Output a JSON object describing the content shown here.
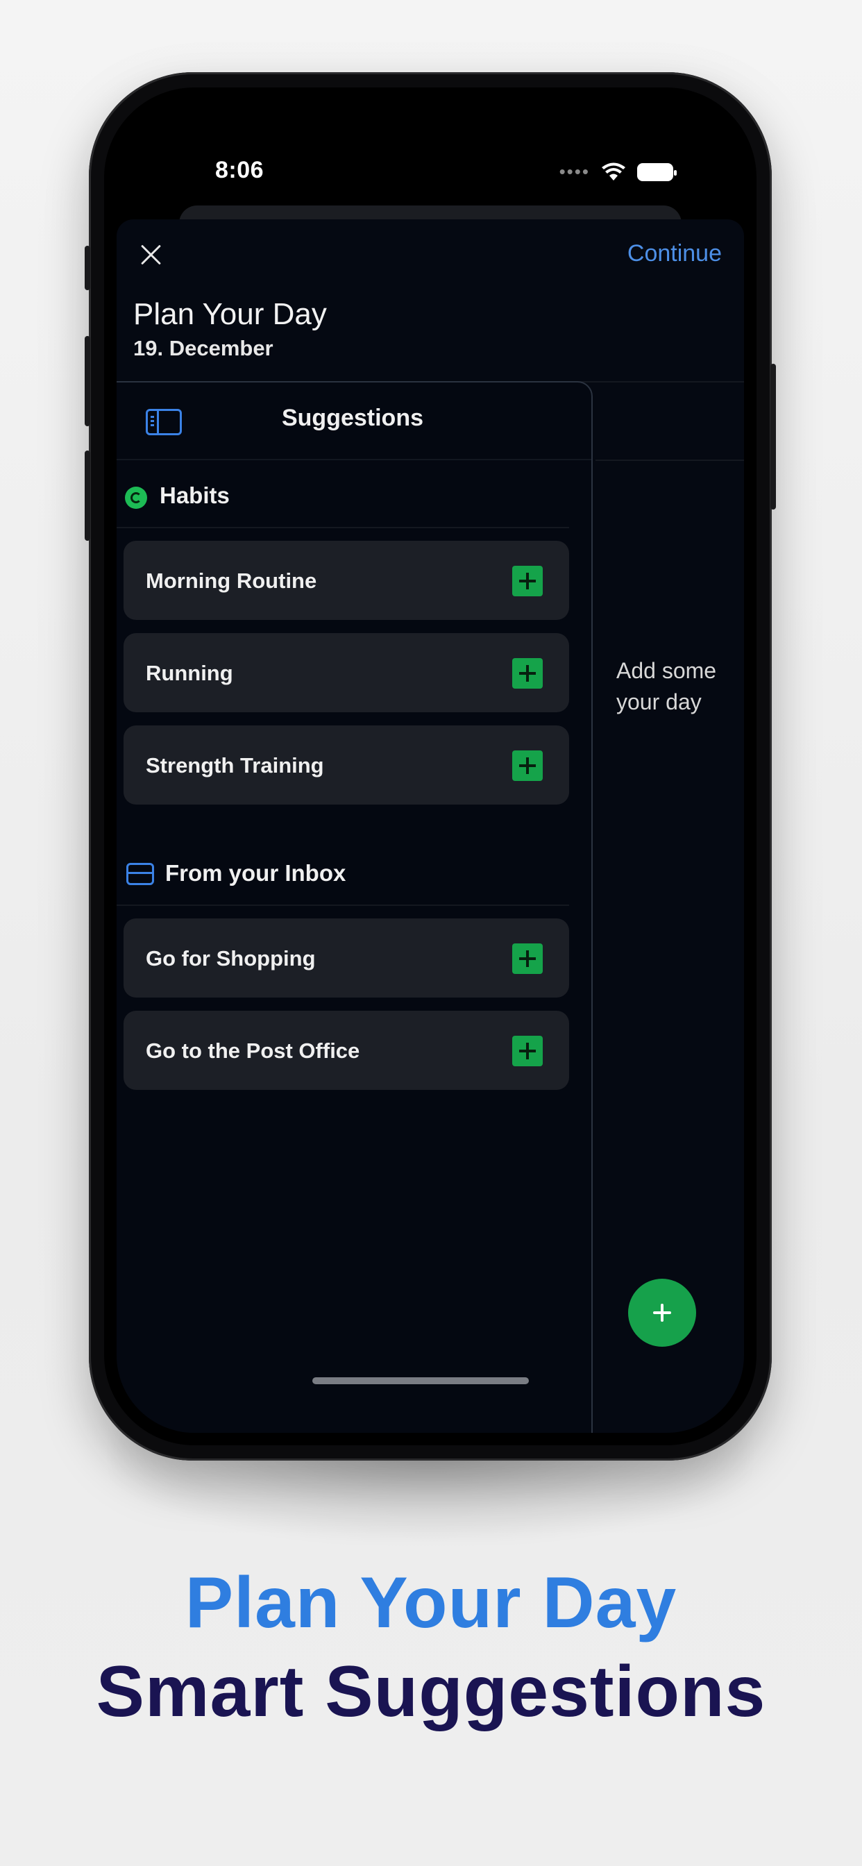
{
  "status_bar": {
    "time": "8:06",
    "signal_dots": "••••",
    "icons": [
      "wifi-icon",
      "battery-icon"
    ]
  },
  "sheet": {
    "title": "Plan Your Day",
    "date": "19. December",
    "continue_label": "Continue",
    "empty_state": "Add some\nyour day"
  },
  "suggestions": {
    "title": "Suggestions",
    "sections": [
      {
        "title": "Habits",
        "icon": "habit-cycle-icon",
        "items": [
          "Morning Routine",
          "Running",
          "Strength Training"
        ]
      },
      {
        "title": "From your Inbox",
        "icon": "inbox-icon",
        "items": [
          "Go for Shopping",
          "Go to the Post Office"
        ]
      }
    ]
  },
  "caption": {
    "line1": "Plan Your Day",
    "line2": "Smart Suggestions"
  },
  "colors": {
    "accent_blue": "#2f7ee0",
    "accent_green": "#16a14b",
    "caption_dark": "#1a1452",
    "card_bg": "#1c1f26",
    "sheet_bg": "#050912"
  }
}
